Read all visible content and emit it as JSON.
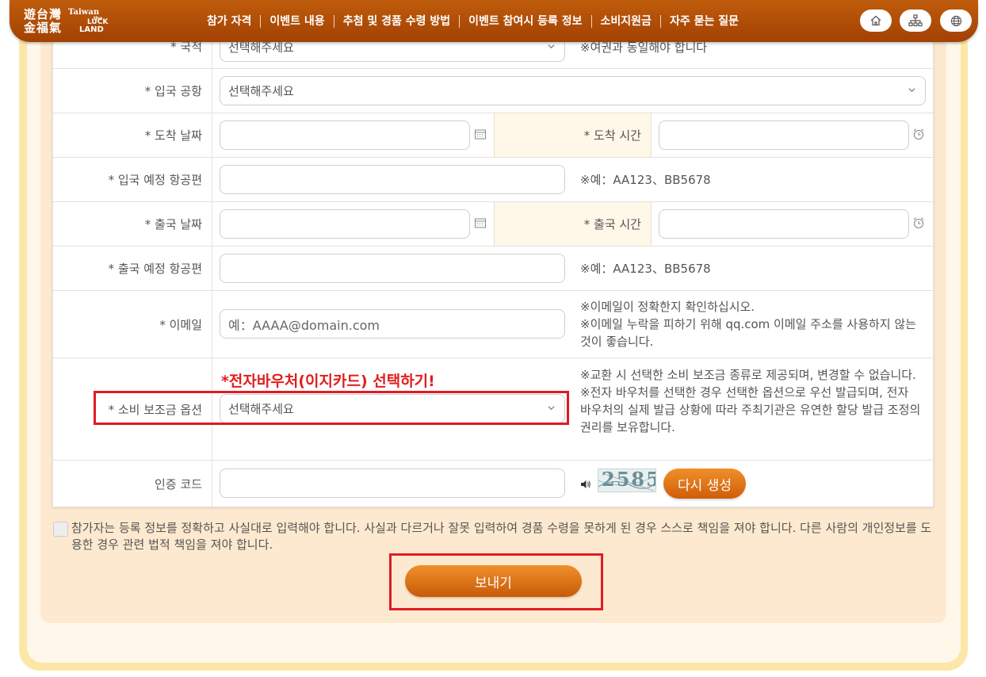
{
  "header": {
    "logo": {
      "zh_line1": "遊台灣",
      "zh_line2": "金福氣",
      "en_taiwan": "Taiwan",
      "en_the": "the",
      "en_luck": "LUCK",
      "en_land": "LAND"
    },
    "nav": [
      "참가 자격",
      "이벤트 내용",
      "추첨 및 경품 수령 방법",
      "이벤트 참여시 등록 정보",
      "소비지원금",
      "자주 묻는 질문"
    ],
    "icons": [
      "home-icon",
      "sitemap-icon",
      "globe-icon"
    ]
  },
  "form": {
    "nationality": {
      "label": "* 국적",
      "value": "선택해주세요",
      "note": "※여권과 동일해야 합니다"
    },
    "entry_airport": {
      "label": "* 입국 공항",
      "value": "선택해주세요"
    },
    "arrival": {
      "date_label": "* 도착 날짜",
      "time_label": "* 도착 시간",
      "date_value": "",
      "time_value": ""
    },
    "arrival_flight": {
      "label": "* 입국 예정 항공편",
      "value": "",
      "note": "※예：AA123、BB5678"
    },
    "departure": {
      "date_label": "* 출국 날짜",
      "time_label": "* 출국 시간",
      "date_value": "",
      "time_value": ""
    },
    "departure_flight": {
      "label": "* 출국 예정 항공편",
      "value": "",
      "note": "※예：AA123、BB5678"
    },
    "email": {
      "label": "* 이메일",
      "placeholder": "예：AAAA@domain.com",
      "note_1": "※이메일이 정확한지 확인하십시오.",
      "note_2": "※이메일 누락을 피하기 위해 qq.com 이메일 주소를 사용하지 않는 것이 좋습니다."
    },
    "subsidy": {
      "label": "* 소비 보조금 옵션",
      "value": "선택해주세요",
      "highlight": "*전자바우처(이지카드) 선택하기!",
      "note_1": "※교환 시 선택한 소비 보조금 종류로 제공되며, 변경할 수 없습니다.",
      "note_2": "※전자 바우처를 선택한 경우 선택한 옵션으로 우선 발급되며, 전자 바우처의 실제 발급 상황에 따라 주최기관은 유연한 할당 발급 조정의 권리를 보유합니다."
    },
    "captcha": {
      "label": "인증 코드",
      "value": "",
      "image_text": "2585",
      "regenerate_label": "다시 생성"
    },
    "agreement": "참가자는 등록 정보를 정확하고 사실대로 입력해야 합니다. 사실과 다르거나 잘못 입력하여 경품 수령을 못하게 된 경우 스스로 책임을 져야 합니다. 다른 사람의 개인정보를 도용한 경우 관련 법적 책임을 져야 합니다.",
    "submit_label": "보내기"
  },
  "colors": {
    "header": "#b04c07",
    "accent_button": "#e07a1c",
    "highlight_red": "#e01b24",
    "card_bg": "#fde9cf",
    "label_bg": "#fff7e8"
  }
}
